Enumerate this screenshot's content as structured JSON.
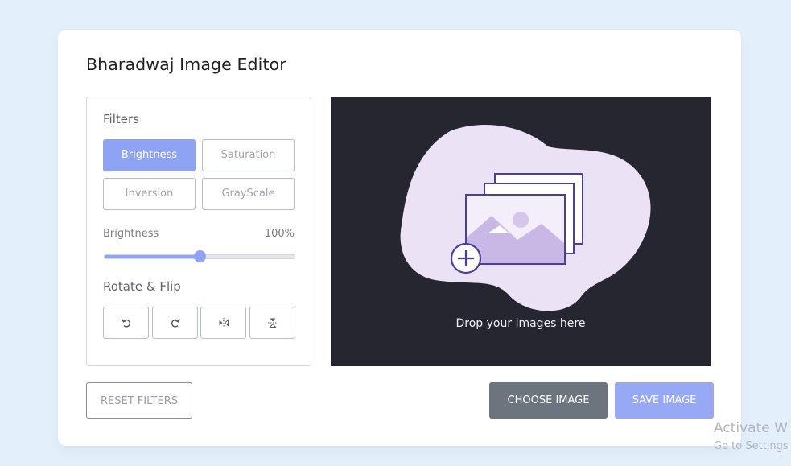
{
  "app": {
    "title": "Bharadwaj Image Editor"
  },
  "filters": {
    "heading": "Filters",
    "buttons": [
      {
        "label": "Brightness",
        "active": true
      },
      {
        "label": "Saturation",
        "active": false
      },
      {
        "label": "Inversion",
        "active": false
      },
      {
        "label": "GrayScale",
        "active": false
      }
    ],
    "slider": {
      "name": "Brightness",
      "value_text": "100%",
      "value_fraction": 0.5
    }
  },
  "rotate_flip": {
    "heading": "Rotate & Flip",
    "icons": [
      "rotate-left-icon",
      "rotate-right-icon",
      "flip-horizontal-icon",
      "flip-vertical-icon"
    ]
  },
  "preview": {
    "drop_text": "Drop your images here"
  },
  "actions": {
    "reset": "Reset Filters",
    "choose": "Choose Image",
    "save": "Save Image"
  },
  "watermark": {
    "line1": "Activate W",
    "line2": "Go to Settings"
  },
  "colors": {
    "accent": "#8ea3f4",
    "choose_button": "#6c757d",
    "save_button": "#97a8f5",
    "preview_bg": "#252630",
    "page_bg": "#e3f0fb"
  }
}
